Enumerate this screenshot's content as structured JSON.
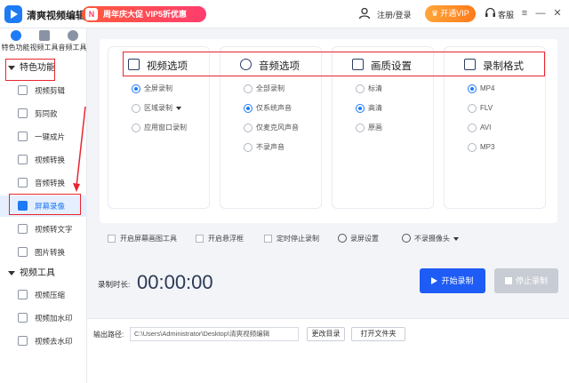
{
  "titlebar": {
    "app_title": "清爽视频编辑",
    "promo": "周年庆大促 VIP5折优惠",
    "promo_icon": "N",
    "login": "注册/登录",
    "vip_button": "开通VIP",
    "service": "客服",
    "menu_glyph": "≡",
    "minimize_glyph": "—",
    "close_glyph": "✕"
  },
  "sidebar": {
    "top_tabs": [
      {
        "label": "特色功能",
        "icon": "star-icon"
      },
      {
        "label": "视频工具",
        "icon": "video-icon"
      },
      {
        "label": "音频工具",
        "icon": "audio-icon"
      }
    ],
    "group_featured": "特色功能",
    "featured_items": [
      "视频剪辑",
      "剪同款",
      "一键成片",
      "视频转换",
      "音频转换",
      "屏幕录像",
      "视频转文字",
      "图片转换"
    ],
    "active_item": "屏幕录像",
    "group_video_tools": "视频工具",
    "video_tool_items": [
      "视频压缩",
      "视频加水印",
      "视频去水印"
    ]
  },
  "cards": [
    {
      "title": "视频选项",
      "icon": "screen-play-icon",
      "options": [
        {
          "label": "全屏录制",
          "selected": true
        },
        {
          "label": "区域录制",
          "selected": false,
          "dropdown": true
        },
        {
          "label": "应用窗口录制",
          "selected": false
        }
      ]
    },
    {
      "title": "音频选项",
      "icon": "audio-disc-icon",
      "options": [
        {
          "label": "全部录制",
          "selected": false
        },
        {
          "label": "仅系统声音",
          "selected": true
        },
        {
          "label": "仅麦克风声音",
          "selected": false
        },
        {
          "label": "不录声音",
          "selected": false
        }
      ]
    },
    {
      "title": "画质设置",
      "icon": "hd-icon",
      "options": [
        {
          "label": "标清",
          "selected": false
        },
        {
          "label": "高清",
          "selected": true
        },
        {
          "label": "原画",
          "selected": false
        }
      ]
    },
    {
      "title": "录制格式",
      "icon": "file-format-icon",
      "options": [
        {
          "label": "MP4",
          "selected": true
        },
        {
          "label": "FLV",
          "selected": false
        },
        {
          "label": "AVI",
          "selected": false
        },
        {
          "label": "MP3",
          "selected": false
        }
      ]
    }
  ],
  "toolbar": {
    "screen_draw": "开启屏幕画图工具",
    "floating_window": "开启悬浮框",
    "timed_stop": "定时停止录制",
    "record_settings": "录屏设置",
    "camera": "不录摄像头"
  },
  "recorder": {
    "duration_label": "录制时长:",
    "duration": "00:00:00",
    "start_button": "开始录制",
    "stop_button": "停止录制"
  },
  "output": {
    "label": "输出路径:",
    "path": "C:\\Users\\Administrator\\Desktop\\清爽视频编辑",
    "change_dir": "更改目录",
    "open_folder": "打开文件夹"
  },
  "colors": {
    "accent": "#1e7bf5",
    "annotation": "#e8262f",
    "vip": "#ff8a1f"
  }
}
